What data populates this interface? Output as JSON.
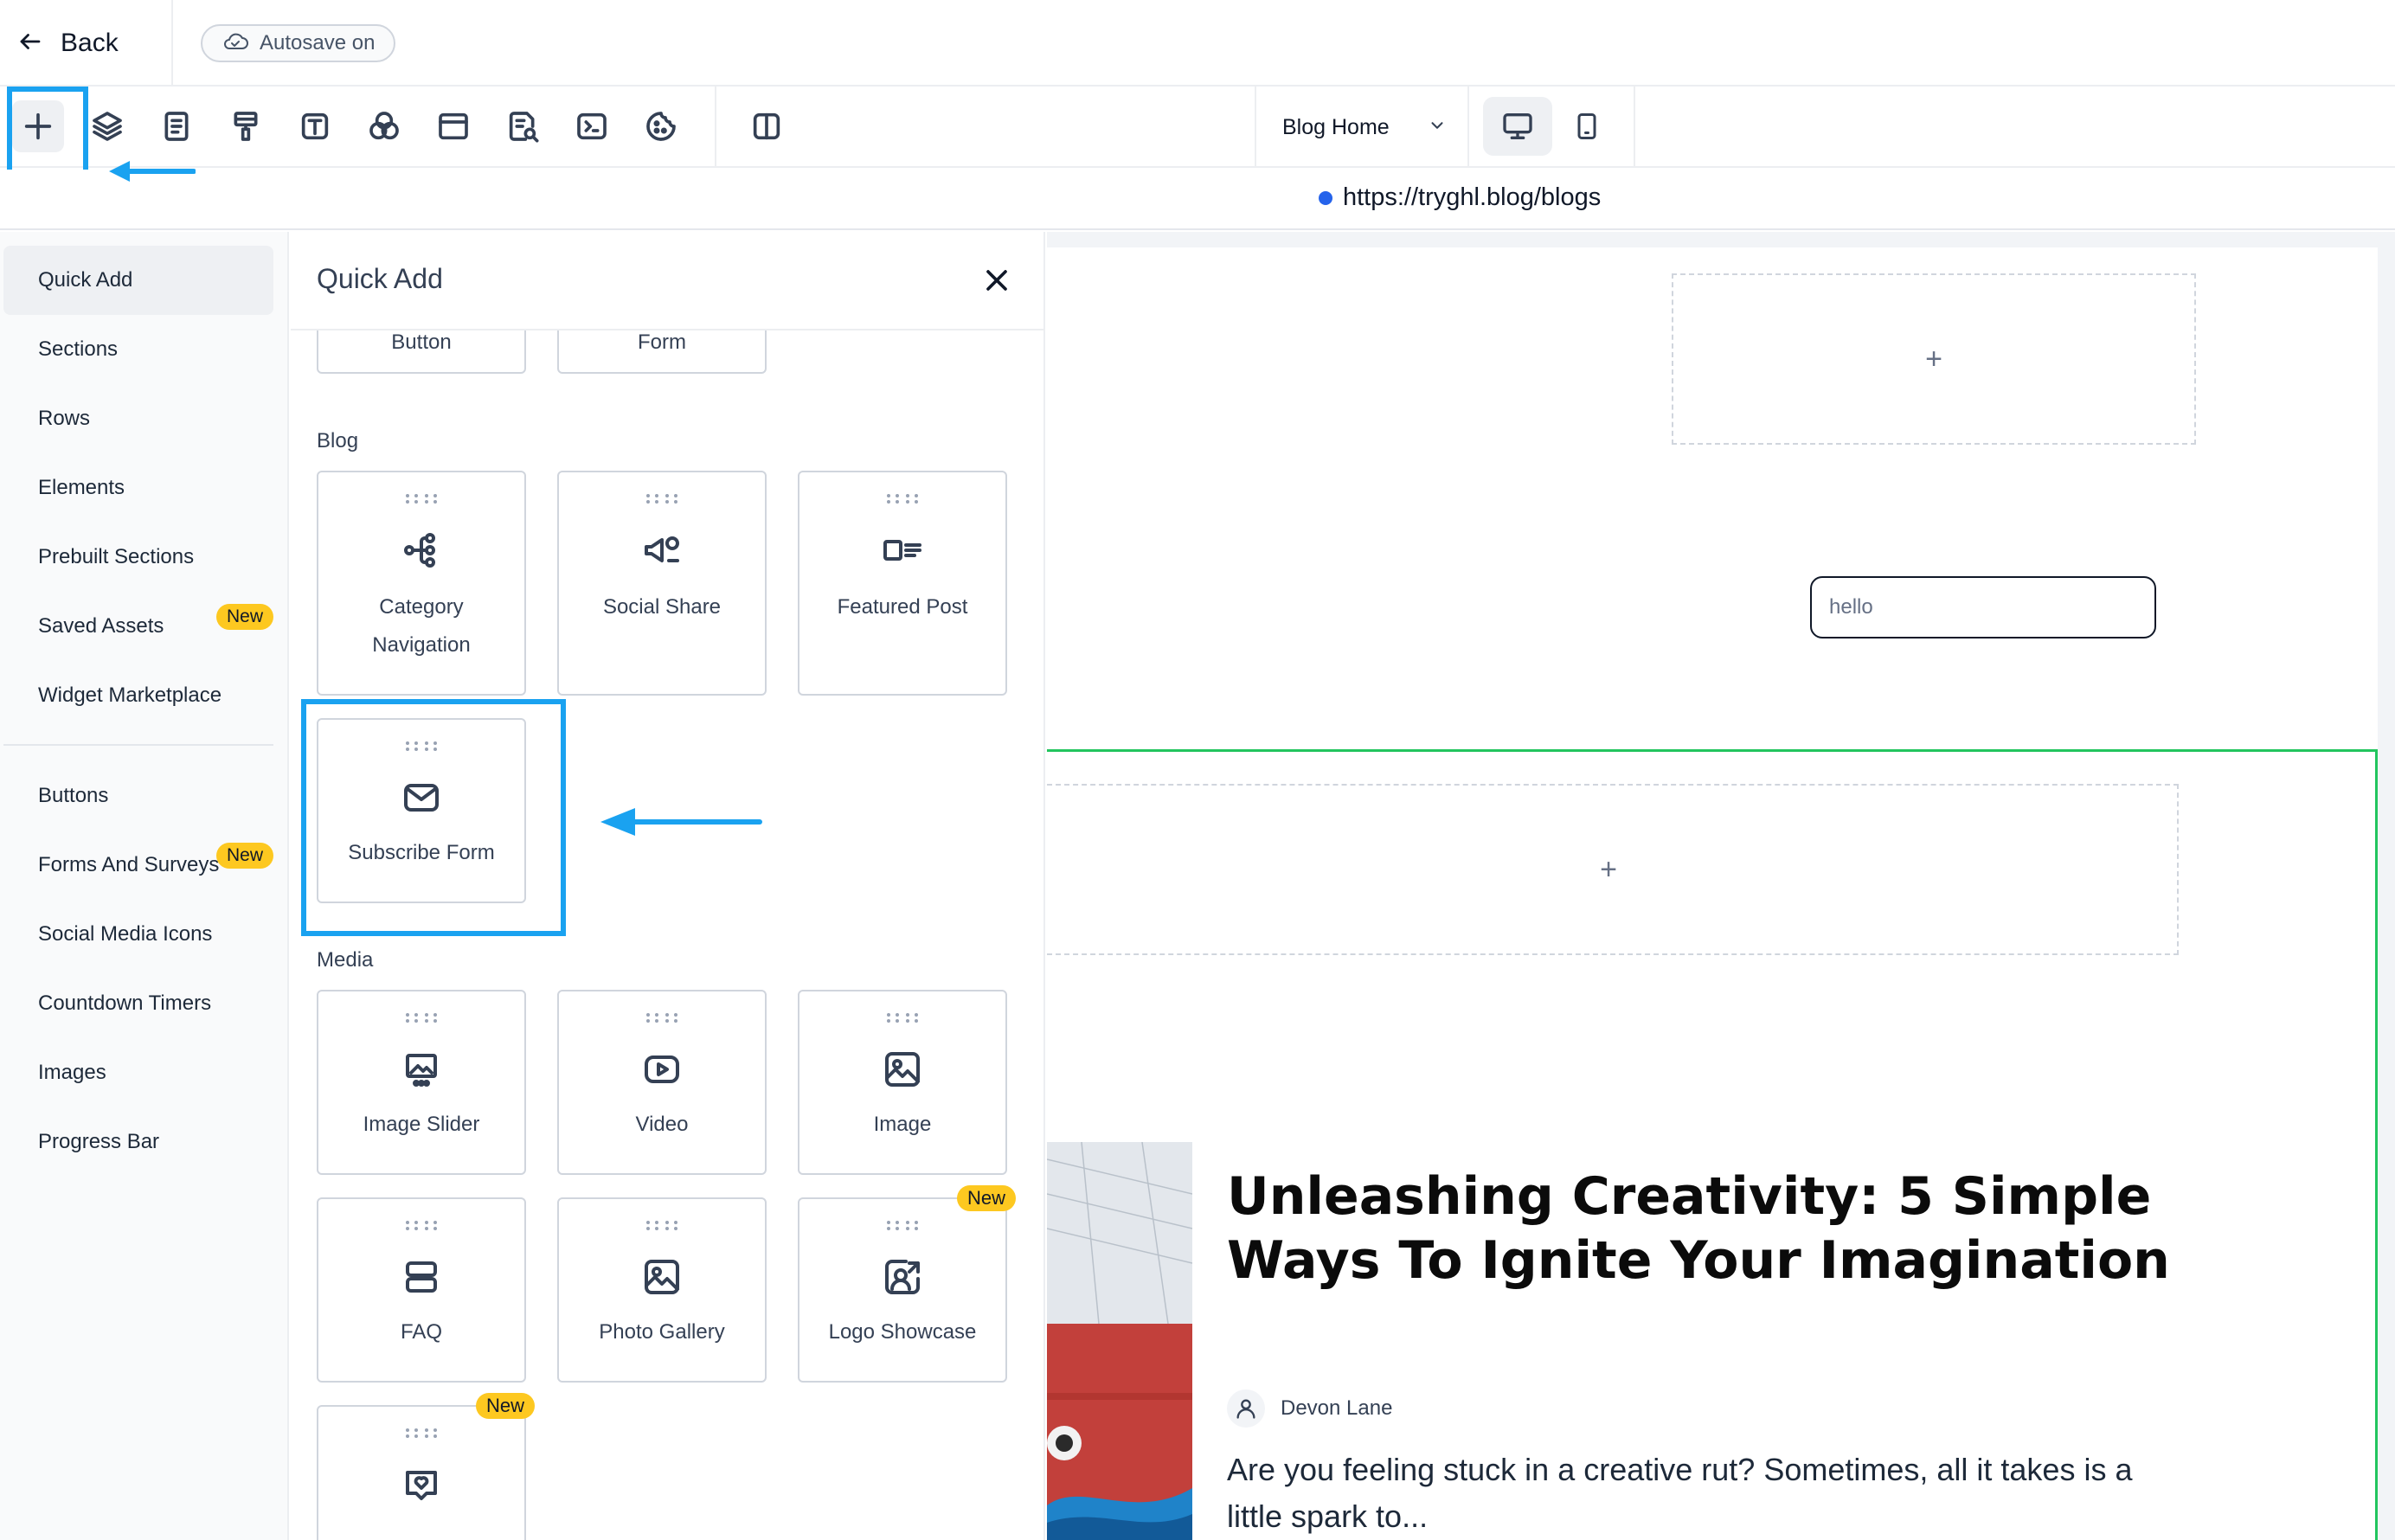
{
  "header": {
    "back_label": "Back",
    "autosave_label": "Autosave on"
  },
  "toolbar": {
    "page_select": "Blog Home",
    "tools": [
      "add",
      "layers",
      "pages",
      "styles",
      "typography",
      "colors",
      "layout",
      "seo",
      "code",
      "cookies",
      "columns"
    ]
  },
  "url": {
    "text": "https://tryghl.blog/blogs"
  },
  "sidebar": {
    "items": [
      {
        "label": "Quick Add"
      },
      {
        "label": "Sections"
      },
      {
        "label": "Rows"
      },
      {
        "label": "Elements"
      },
      {
        "label": "Prebuilt Sections"
      },
      {
        "label": "Saved Assets",
        "badge": "New"
      },
      {
        "label": "Widget Marketplace"
      }
    ],
    "items2": [
      {
        "label": "Buttons"
      },
      {
        "label": "Forms And Surveys",
        "badge": "New"
      },
      {
        "label": "Social Media Icons"
      },
      {
        "label": "Countdown Timers"
      },
      {
        "label": "Images"
      },
      {
        "label": "Progress Bar"
      }
    ]
  },
  "quick_add": {
    "title": "Quick Add",
    "top_cards": [
      "Button",
      "Form"
    ],
    "sections": {
      "blog": "Blog",
      "media": "Media"
    },
    "blog_cards": [
      {
        "label": "Category Navigation",
        "icon": "category-navigation-icon"
      },
      {
        "label": "Social Share",
        "icon": "social-share-icon"
      },
      {
        "label": "Featured Post",
        "icon": "featured-post-icon"
      },
      {
        "label": "Subscribe Form",
        "icon": "mail-icon"
      }
    ],
    "media_cards": [
      {
        "label": "Image Slider",
        "icon": "image-slider-icon"
      },
      {
        "label": "Video",
        "icon": "video-icon"
      },
      {
        "label": "Image",
        "icon": "image-icon"
      },
      {
        "label": "FAQ",
        "icon": "faq-icon"
      },
      {
        "label": "Photo Gallery",
        "icon": "photo-gallery-icon"
      },
      {
        "label": "Logo Showcase",
        "icon": "logo-showcase-icon",
        "badge": "New"
      },
      {
        "label": "",
        "icon": "heart-chat-icon",
        "badge": "New"
      }
    ]
  },
  "canvas": {
    "input_value": "hello",
    "add_symbol": "+",
    "post": {
      "title": "Unleashing Creativity: 5 Simple Ways To Ignite Your Imagination",
      "author": "Devon Lane",
      "excerpt": "Are you feeling stuck in a creative rut? Sometimes, all it takes is a little spark to..."
    }
  },
  "colors": {
    "highlight": "#1aa2f0",
    "badge": "#fdc820",
    "section_outline": "#22c55e",
    "url_dot": "#2563eb"
  }
}
